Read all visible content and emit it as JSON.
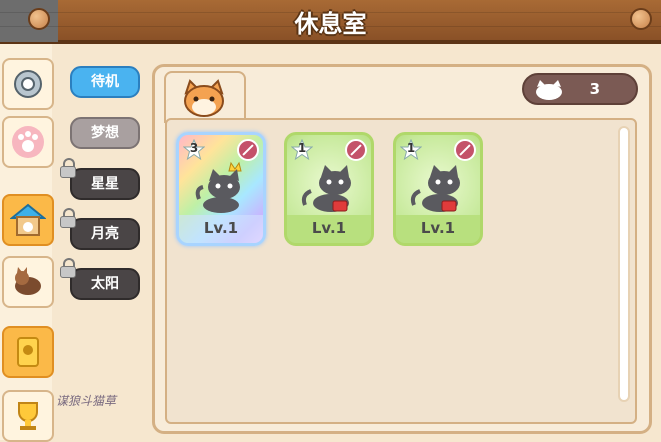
{
  "header": {
    "title": "休息室"
  },
  "tabs": [
    {
      "label": "待机",
      "state": "active"
    },
    {
      "label": "梦想",
      "state": "normal"
    },
    {
      "label": "星星",
      "state": "locked"
    },
    {
      "label": "月亮",
      "state": "locked"
    },
    {
      "label": "太阳",
      "state": "locked"
    }
  ],
  "panel": {
    "cat_count": "3"
  },
  "cards": [
    {
      "level": "Lv.1",
      "count": "3",
      "style": "rainbow"
    },
    {
      "level": "Lv.1",
      "count": "1",
      "style": "green"
    },
    {
      "level": "Lv.1",
      "count": "1",
      "style": "green"
    }
  ],
  "watermark": {
    "line1": "谋狼斗猫草",
    "line2": ""
  },
  "colors": {
    "accent_blue": "#4ab3f0",
    "header_brown": "#8a5127",
    "card_green": "#b0d86a"
  }
}
